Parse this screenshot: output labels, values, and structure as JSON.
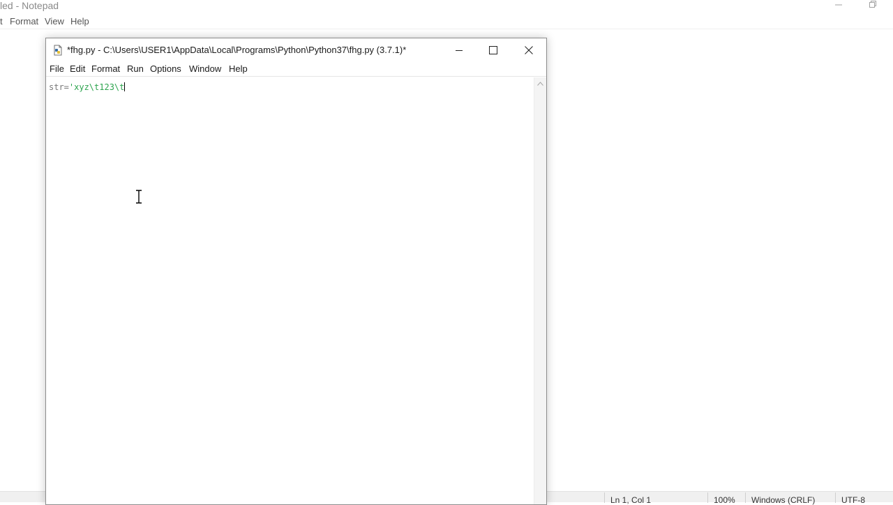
{
  "notepad": {
    "title": "led - Notepad",
    "menu": [
      "t",
      "Format",
      "View",
      "Help"
    ],
    "status": {
      "position": "Ln 1, Col 1",
      "zoom": "100%",
      "line_ending": "Windows (CRLF)",
      "encoding": "UTF-8"
    }
  },
  "idle": {
    "title": "*fhg.py - C:\\Users\\USER1\\AppData\\Local\\Programs\\Python\\Python37\\fhg.py (3.7.1)*",
    "menu": [
      "File",
      "Edit",
      "Format",
      "Run",
      "Options",
      "Window",
      "Help"
    ],
    "code": {
      "identifier": "str=",
      "string": "'xyz\\t123\\t"
    }
  },
  "colors": {
    "string_literal": "#2ea44f",
    "identifier": "#7a7a7a"
  },
  "icons": {
    "idle_app": "python-file-icon",
    "minimize": "minimize-icon",
    "maximize": "maximize-icon",
    "close": "close-icon",
    "scroll_up": "chevron-up-icon",
    "mouse_cursor": "text-cursor-icon"
  }
}
